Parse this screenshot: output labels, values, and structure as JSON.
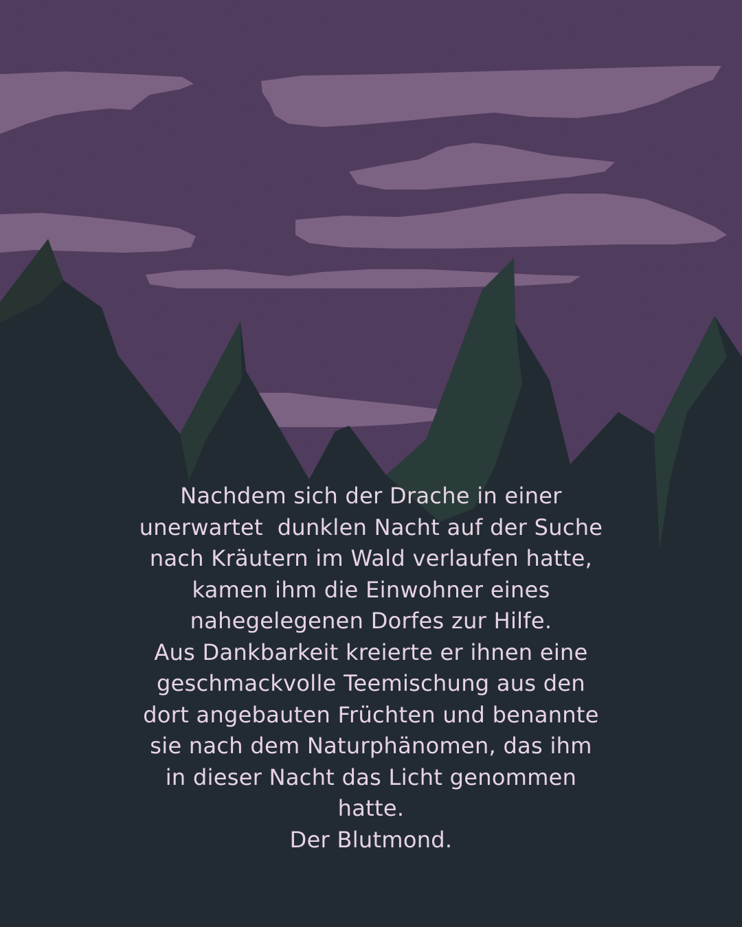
{
  "colors": {
    "sky": "#4a3558",
    "cloud": "#7c6283",
    "mountain_dark": "#222b32",
    "mountain_green": "#2a3c39",
    "text": "#e7d4e4"
  },
  "story": {
    "lines": [
      "Nachdem sich der Drache in einer",
      "unerwartet  dunklen Nacht auf der Suche",
      "nach Kräutern im Wald verlaufen hatte,",
      "kamen ihm die Einwohner eines",
      "nahegelegenen Dorfes zur Hilfe.",
      "Aus Dankbarkeit kreierte er ihnen eine",
      "geschmackvolle Teemischung aus den",
      "dort angebauten Früchten und benannte",
      "sie nach dem Naturphänomen, das ihm",
      "in dieser Nacht das Licht genommen",
      "hatte.",
      "Der Blutmond."
    ]
  }
}
